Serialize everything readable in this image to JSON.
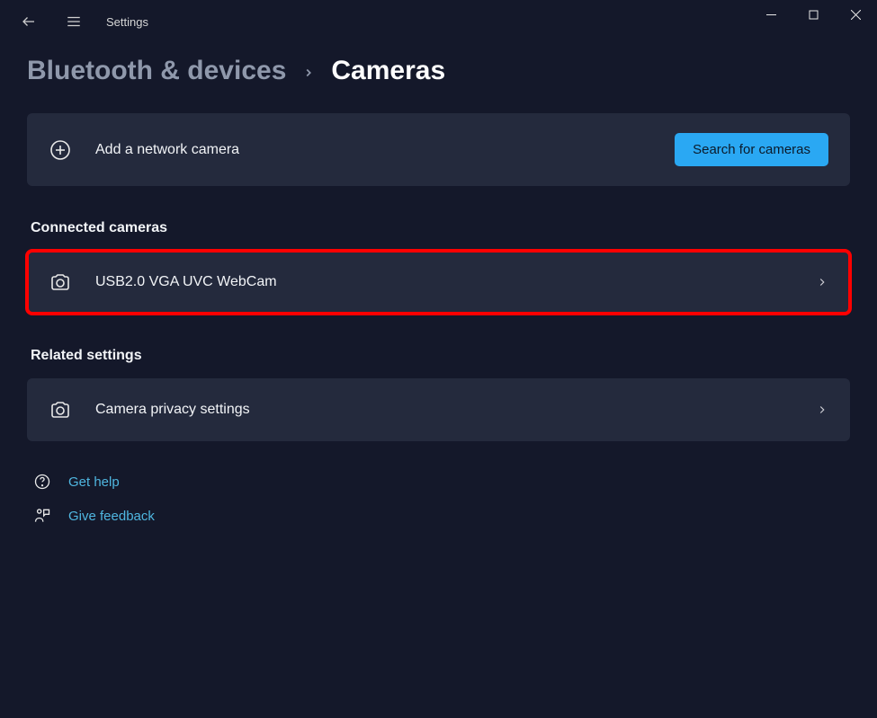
{
  "titlebar": {
    "app_title": "Settings"
  },
  "breadcrumb": {
    "parent": "Bluetooth & devices",
    "current": "Cameras"
  },
  "add_camera": {
    "label": "Add a network camera",
    "button": "Search for cameras"
  },
  "connected": {
    "title": "Connected cameras",
    "items": [
      {
        "label": "USB2.0 VGA UVC WebCam"
      }
    ]
  },
  "related": {
    "title": "Related settings",
    "items": [
      {
        "label": "Camera privacy settings"
      }
    ]
  },
  "links": {
    "help": "Get help",
    "feedback": "Give feedback"
  }
}
